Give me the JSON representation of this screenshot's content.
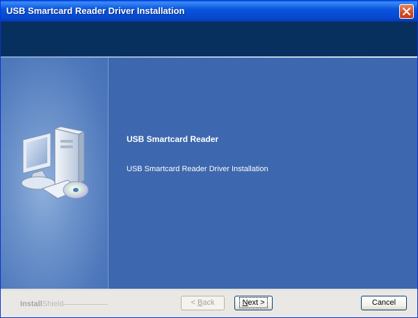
{
  "window": {
    "title": "USB Smartcard Reader Driver Installation"
  },
  "content": {
    "heading": "USB Smartcard Reader",
    "description": "USB Smartcard Reader Driver Installation"
  },
  "footer": {
    "brand_bold": "Install",
    "brand_light": "Shield",
    "back_arrow": "< ",
    "back_mnemonic": "B",
    "back_rest": "ack",
    "next_mnemonic": "N",
    "next_rest": "ext",
    "next_arrow": " >",
    "cancel_label": "Cancel"
  },
  "icons": {
    "close": "close-icon",
    "computer": "computer-cd-icon"
  },
  "colors": {
    "titlebar": "#0a56de",
    "banner": "#07305f",
    "panel": "#3d67ae",
    "footer": "#e9e8e4"
  }
}
